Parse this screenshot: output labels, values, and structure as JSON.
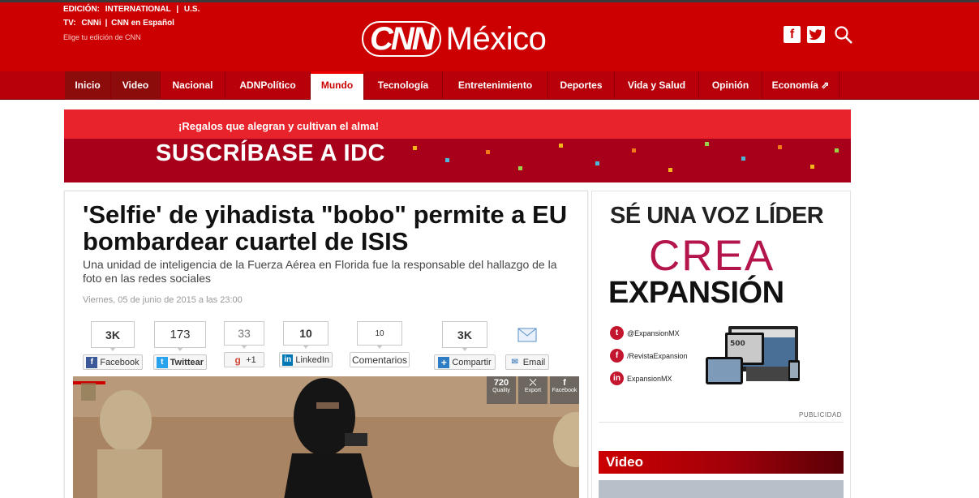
{
  "header": {
    "edition_label": "EDICIÓN:",
    "edition_international": "INTERNATIONAL",
    "edition_us": "U.S.",
    "edition_sep": "|",
    "tv_label": "TV:",
    "tv_cnni": "CNNi",
    "tv_cnn_espanol": "CNN en Español",
    "tv_sep": "|",
    "choose_edition": "Elige tu edición de CNN",
    "logo_cnn": "CNN",
    "logo_mexico": "México",
    "facebook_icon": "facebook-icon",
    "twitter_icon": "twitter-icon",
    "search_icon": "search-icon"
  },
  "nav": {
    "items": [
      {
        "label": "Inicio"
      },
      {
        "label": "Video"
      },
      {
        "label": "Nacional"
      },
      {
        "label": "ADNPolítico"
      },
      {
        "label": "Mundo"
      },
      {
        "label": "Tecnología"
      },
      {
        "label": "Entretenimiento"
      },
      {
        "label": "Deportes"
      },
      {
        "label": "Vida y Salud"
      },
      {
        "label": "Opinión"
      },
      {
        "label": "Economía ⇗"
      }
    ],
    "active": "Mundo"
  },
  "promo": {
    "tagline": "¡Regalos que alegran y cultivan el alma!",
    "title": "SUSCRÍBASE A IDC"
  },
  "article": {
    "headline": "'Selfie' de yihadista \"bobo\" permite a EU bombardear cuartel de ISIS",
    "dek": "Una unidad de inteligencia de la Fuerza Aérea en Florida fue la responsable del hallazgo de la foto en las redes sociales",
    "date": "Viernes, 05 de junio de 2015 a las 23:00",
    "share": [
      {
        "count": "3K",
        "label": "Facebook",
        "icon": "facebook-icon"
      },
      {
        "count": "173",
        "label": "Twittear",
        "icon": "twitter-icon"
      },
      {
        "count": "33",
        "label": "+1",
        "icon": "google-plus-icon"
      },
      {
        "count": "10",
        "label": "LinkedIn",
        "icon": "linkedin-icon"
      },
      {
        "count": "10",
        "label": "Comentarios",
        "icon": ""
      },
      {
        "count": "3K",
        "label": "Compartir",
        "icon": "plus-icon"
      },
      {
        "count": "",
        "label": "Email",
        "icon": "email-icon"
      }
    ],
    "video_controls": [
      {
        "top": "720",
        "label": "Quality"
      },
      {
        "top": "⤬",
        "label": "Export"
      },
      {
        "top": "f",
        "label": "Facebook"
      }
    ]
  },
  "sidebar": {
    "ad_line1": "SÉ UNA VOZ LÍDER",
    "ad_line2": "CREA",
    "ad_line3": "EXPANSIÓN",
    "social": [
      {
        "icon": "twitter-icon",
        "text": "@ExpansionMX"
      },
      {
        "icon": "facebook-icon",
        "text": "/RevistaExpansion"
      },
      {
        "icon": "linkedin-icon",
        "text": "ExpansionMX"
      }
    ],
    "ad_label": "PUBLICIDAD",
    "video_header": "Video"
  },
  "colors": {
    "brand_red": "#cc0000",
    "nav_red": "#b8000a",
    "accent_magenta": "#b4154c"
  }
}
